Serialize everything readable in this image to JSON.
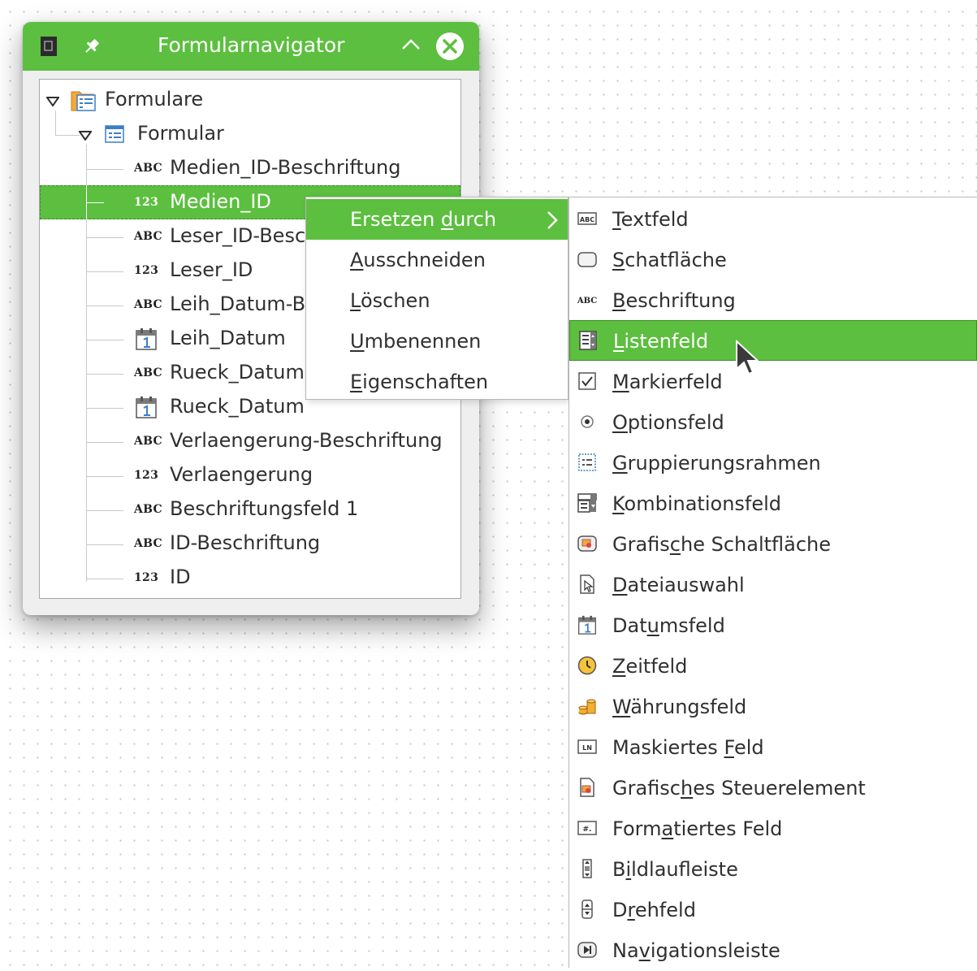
{
  "navigator": {
    "title": "Formularnavigator",
    "tree": [
      {
        "label": "Formulare"
      },
      {
        "label": "Formular"
      },
      {
        "badge": "ABC",
        "label": "Medien_ID-Beschriftung"
      },
      {
        "badge": "123",
        "label": "Medien_ID",
        "selected": true
      },
      {
        "badge": "ABC",
        "label": "Leser_ID-Besc"
      },
      {
        "badge": "123",
        "label": "Leser_ID"
      },
      {
        "badge": "ABC",
        "label": "Leih_Datum-B"
      },
      {
        "icon": "calendar-icon",
        "label": "Leih_Datum"
      },
      {
        "badge": "ABC",
        "label": "Rueck_Datum"
      },
      {
        "icon": "calendar-icon",
        "label": "Rueck_Datum"
      },
      {
        "badge": "ABC",
        "label": "Verlaengerung-Beschriftung"
      },
      {
        "badge": "123",
        "label": "Verlaengerung"
      },
      {
        "badge": "ABC",
        "label": "Beschriftungsfeld 1"
      },
      {
        "badge": "ABC",
        "label": "ID-Beschriftung"
      },
      {
        "badge": "123",
        "label": "ID"
      }
    ]
  },
  "context_menu": {
    "items": [
      {
        "pre": "Ersetzen ",
        "mn": "d",
        "post": "urch",
        "active": true,
        "submenu": true
      },
      {
        "pre": "",
        "mn": "A",
        "post": "usschneiden"
      },
      {
        "pre": "",
        "mn": "L",
        "post": "öschen"
      },
      {
        "pre": "",
        "mn": "U",
        "post": "mbenennen"
      },
      {
        "pre": "",
        "mn": "E",
        "post": "igenschaften"
      }
    ]
  },
  "submenu": {
    "items": [
      {
        "pre": "",
        "mn": "T",
        "post": "extfeld",
        "icon": "textbox-icon"
      },
      {
        "pre": "",
        "mn": "S",
        "post": "chatfläche",
        "icon": "push-button-icon"
      },
      {
        "pre": "",
        "mn": "B",
        "post": "eschriftung",
        "icon": "label-icon"
      },
      {
        "pre": "",
        "mn": "L",
        "post": "istenfeld",
        "icon": "listbox-icon",
        "active": true
      },
      {
        "pre": "",
        "mn": "M",
        "post": "arkierfeld",
        "icon": "checkbox-icon"
      },
      {
        "pre": "",
        "mn": "O",
        "post": "ptionsfeld",
        "icon": "radio-icon"
      },
      {
        "pre": "",
        "mn": "G",
        "post": "ruppierungsrahmen",
        "icon": "group-box-icon"
      },
      {
        "pre": "",
        "mn": "K",
        "post": "ombinationsfeld",
        "icon": "combobox-icon"
      },
      {
        "pre": "Grafis",
        "mn": "c",
        "post": "he Schaltfläche",
        "icon": "image-button-icon"
      },
      {
        "pre": "",
        "mn": "D",
        "post": "ateiauswahl",
        "icon": "file-selection-icon"
      },
      {
        "pre": "Dat",
        "mn": "u",
        "post": "msfeld",
        "icon": "calendar-icon"
      },
      {
        "pre": "",
        "mn": "Z",
        "post": "eitfeld",
        "icon": "clock-icon"
      },
      {
        "pre": "",
        "mn": "W",
        "post": "ährungsfeld",
        "icon": "currency-icon"
      },
      {
        "pre": "Maskiertes ",
        "mn": "F",
        "post": "eld",
        "icon": "pattern-field-icon"
      },
      {
        "pre": "Grafisc",
        "mn": "h",
        "post": "es Steuerelement",
        "icon": "image-control-icon"
      },
      {
        "pre": "Form",
        "mn": "a",
        "post": "tiertes Feld",
        "icon": "formatted-field-icon"
      },
      {
        "pre": "B",
        "mn": "i",
        "post": "ldlaufleiste",
        "icon": "scrollbar-icon"
      },
      {
        "pre": "D",
        "mn": "r",
        "post": "ehfeld",
        "icon": "spin-button-icon"
      },
      {
        "pre": "Na",
        "mn": "v",
        "post": "igationsleiste",
        "icon": "navigation-bar-icon"
      }
    ]
  },
  "colors": {
    "accent": "#5cbf3f",
    "text": "#303030"
  }
}
